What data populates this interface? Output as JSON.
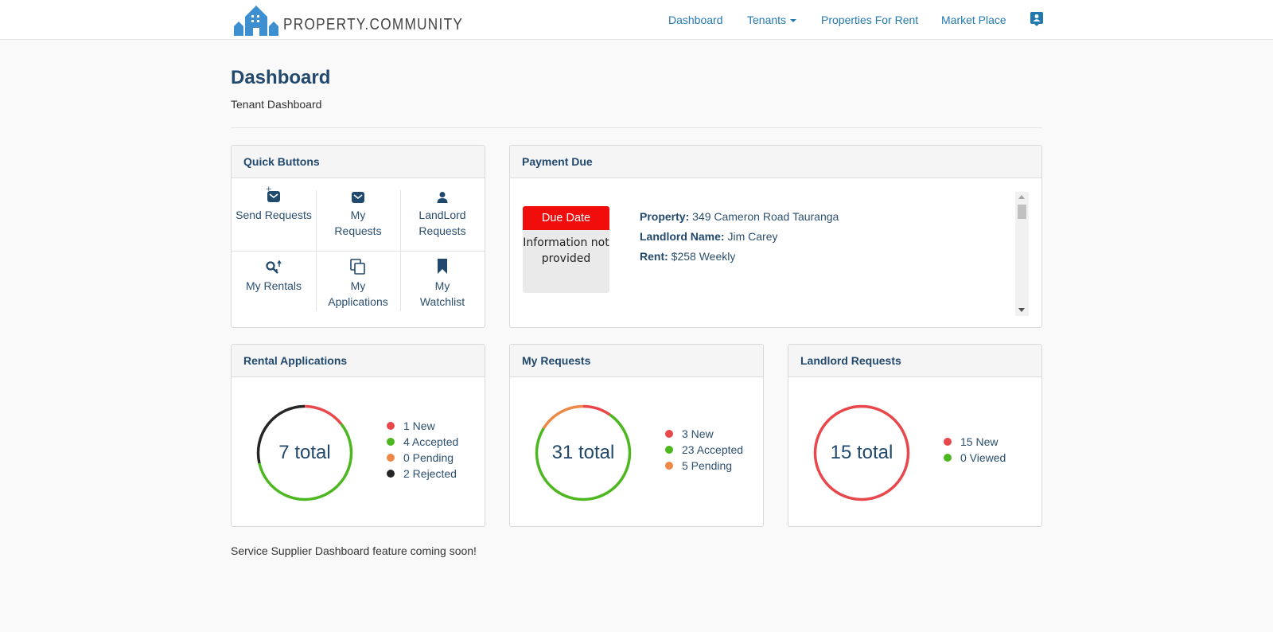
{
  "brand": {
    "name": "PROPERTY.COMMUNITY"
  },
  "nav": {
    "dashboard": "Dashboard",
    "tenants": "Tenants",
    "properties_for_rent": "Properties For Rent",
    "market_place": "Market Place",
    "profile_icon": "contact-card-icon"
  },
  "header": {
    "title": "Dashboard",
    "subtitle": "Tenant Dashboard"
  },
  "quick_buttons": {
    "title": "Quick Buttons",
    "items": [
      {
        "label": "Send Requests",
        "icon": "envelope-plus-icon"
      },
      {
        "label": "My Requests",
        "icon": "envelope-icon"
      },
      {
        "label": "LandLord Requests",
        "icon": "user-icon"
      },
      {
        "label": "My Rentals",
        "icon": "key-icon"
      },
      {
        "label": "My Applications",
        "icon": "copy-icon"
      },
      {
        "label": "My Watchlist",
        "icon": "bookmark-icon"
      }
    ]
  },
  "payment_due": {
    "title": "Payment Due",
    "due_date_label": "Due Date",
    "due_date_value": "Information not provided",
    "property_label": "Property:",
    "property_value": "349 Cameron Road Tauranga",
    "landlord_label": "Landlord Name:",
    "landlord_value": "Jim Carey",
    "rent_label": "Rent:",
    "rent_value": "$258 Weekly"
  },
  "colors": {
    "new": "#e8474b",
    "accepted": "#4cb71e",
    "pending": "#ef8747",
    "rejected": "#262626",
    "viewed": "#4cb71e"
  },
  "cards": {
    "rental_applications": {
      "title": "Rental Applications",
      "total_label": "7 total",
      "legend": [
        {
          "label": "1 New",
          "value": 1,
          "color": "#e8474b"
        },
        {
          "label": "4 Accepted",
          "value": 4,
          "color": "#4cb71e"
        },
        {
          "label": "0 Pending",
          "value": 0,
          "color": "#ef8747"
        },
        {
          "label": "2 Rejected",
          "value": 2,
          "color": "#262626"
        }
      ]
    },
    "my_requests": {
      "title": "My Requests",
      "total_label": "31 total",
      "legend": [
        {
          "label": "3 New",
          "value": 3,
          "color": "#e8474b"
        },
        {
          "label": "23 Accepted",
          "value": 23,
          "color": "#4cb71e"
        },
        {
          "label": "5 Pending",
          "value": 5,
          "color": "#ef8747"
        }
      ]
    },
    "landlord_requests": {
      "title": "Landlord Requests",
      "total_label": "15 total",
      "legend": [
        {
          "label": "15 New",
          "value": 15,
          "color": "#e8474b"
        },
        {
          "label": "0 Viewed",
          "value": 0,
          "color": "#4cb71e"
        }
      ]
    }
  },
  "footer_note": "Service Supplier Dashboard feature coming soon!"
}
